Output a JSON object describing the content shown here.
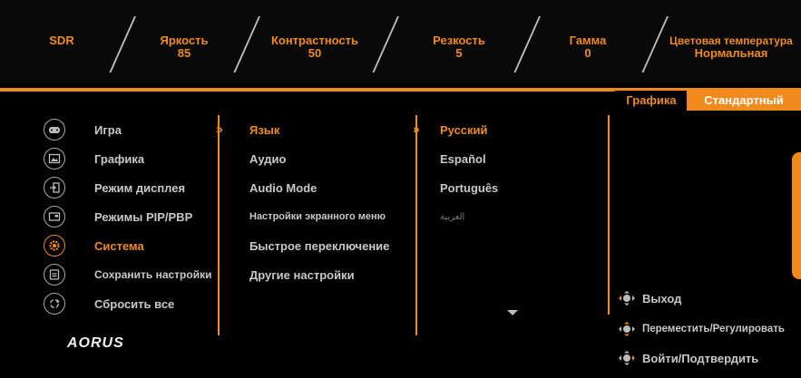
{
  "top_stats": [
    {
      "label": "SDR",
      "value": ""
    },
    {
      "label": "Яркость",
      "value": "85"
    },
    {
      "label": "Контрастность",
      "value": "50"
    },
    {
      "label": "Резкость",
      "value": "5"
    },
    {
      "label": "Гамма",
      "value": "0"
    },
    {
      "label": "Цветовая температура",
      "value": "Нормальная"
    }
  ],
  "tabs": {
    "section": "Графика",
    "mode": "Стандартный"
  },
  "main_menu": [
    {
      "label": "Игра",
      "icon": "gamepad-icon"
    },
    {
      "label": "Графика",
      "icon": "picture-icon"
    },
    {
      "label": "Режим дисплея",
      "icon": "input-icon"
    },
    {
      "label": "Режимы PIP/PBP",
      "icon": "pip-icon"
    },
    {
      "label": "Система",
      "icon": "gear-icon"
    },
    {
      "label": "Сохранить настройки",
      "icon": "save-icon"
    },
    {
      "label": "Сбросить все",
      "icon": "reset-icon"
    }
  ],
  "sub_menu": [
    "Язык",
    "Аудио",
    "Audio Mode",
    "Настройки экранного меню",
    "Быстрое переключение",
    "Другие настройки"
  ],
  "languages": [
    "Русский",
    "Español",
    "Português",
    "العربية"
  ],
  "hints": [
    {
      "label": "Выход",
      "icon": "joystick-left-icon"
    },
    {
      "label": "Переместить/Регулировать",
      "icon": "joystick-updown-icon"
    },
    {
      "label": "Войти/Подтвердить",
      "icon": "joystick-right-icon"
    }
  ],
  "brand": "AORUS",
  "colors": {
    "accent": "#f08a1c",
    "text": "#c8c8c8",
    "background": "#000000"
  }
}
